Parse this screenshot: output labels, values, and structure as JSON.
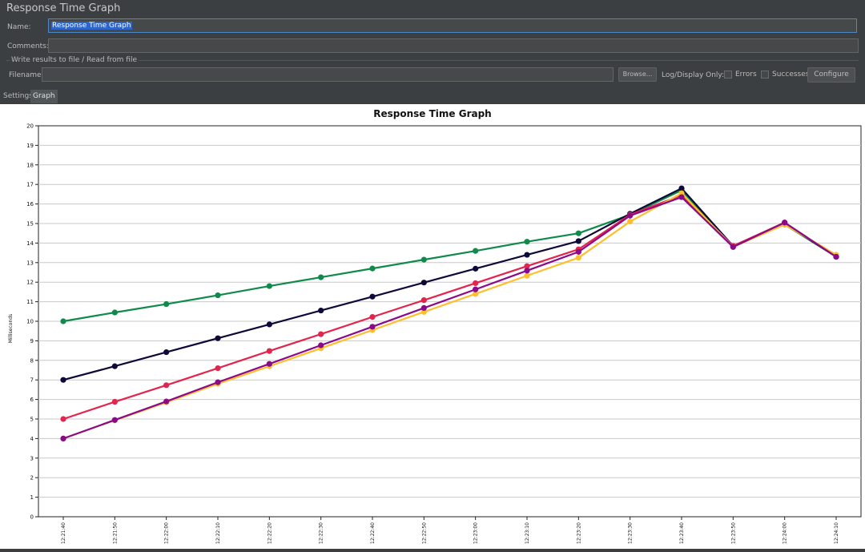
{
  "panel": {
    "title": "Response Time Graph"
  },
  "name_field": {
    "label": "Name:",
    "value": "Response Time Graph"
  },
  "comments_field": {
    "label": "Comments:",
    "value": ""
  },
  "file_section": {
    "title": "Write results to file / Read from file",
    "filename_label": "Filename",
    "filename_value": "",
    "browse_label": "Browse...",
    "log_display_label": "Log/Display Only:",
    "errors_label": "Errors",
    "successes_label": "Successes",
    "configure_label": "Configure"
  },
  "tabs": [
    {
      "label": "Settings"
    },
    {
      "label": "Graph"
    }
  ],
  "chart_data": {
    "type": "line",
    "title": "Response Time Graph",
    "xlabel": "",
    "ylabel": "Milliseconds",
    "ylim": [
      0,
      20
    ],
    "yticks": [
      0,
      1,
      2,
      3,
      4,
      5,
      6,
      7,
      8,
      9,
      10,
      11,
      12,
      13,
      14,
      15,
      16,
      17,
      18,
      19,
      20
    ],
    "grid": true,
    "categories": [
      "12:21:40",
      "12:21:50",
      "12:22:00",
      "12:22:10",
      "12:22:20",
      "12:22:30",
      "12:22:40",
      "12:22:50",
      "12:23:00",
      "12:23:10",
      "12:23:20",
      "12:23:30",
      "12:23:40",
      "12:23:50",
      "12:24:00",
      "12:24:10"
    ],
    "series": [
      {
        "color": "#108a4a",
        "values": [
          10.0,
          10.45,
          10.88,
          11.33,
          11.8,
          12.25,
          12.7,
          13.15,
          13.6,
          14.07,
          14.5,
          15.45,
          16.7,
          13.85,
          14.95,
          13.3
        ]
      },
      {
        "color": "#0d0a3a",
        "values": [
          7.0,
          7.7,
          8.42,
          9.13,
          9.84,
          10.55,
          11.26,
          11.98,
          12.69,
          13.4,
          14.1,
          15.5,
          16.8,
          13.85,
          15.0,
          13.3
        ]
      },
      {
        "color": "#e2254d",
        "values": [
          5.0,
          5.88,
          6.73,
          7.6,
          8.48,
          9.34,
          10.22,
          11.08,
          11.95,
          12.82,
          13.68,
          15.45,
          16.45,
          13.85,
          15.05,
          13.3
        ]
      },
      {
        "color": "#ffbe2c",
        "values": [
          4.0,
          4.93,
          5.85,
          6.8,
          7.7,
          8.62,
          9.55,
          10.48,
          11.4,
          12.33,
          13.25,
          15.1,
          16.55,
          13.8,
          14.95,
          13.4
        ]
      },
      {
        "color": "#8a0a8a",
        "values": [
          4.0,
          4.95,
          5.9,
          6.88,
          7.82,
          8.77,
          9.72,
          10.68,
          11.63,
          12.59,
          13.55,
          15.4,
          16.35,
          13.8,
          15.05,
          13.3
        ]
      }
    ]
  }
}
